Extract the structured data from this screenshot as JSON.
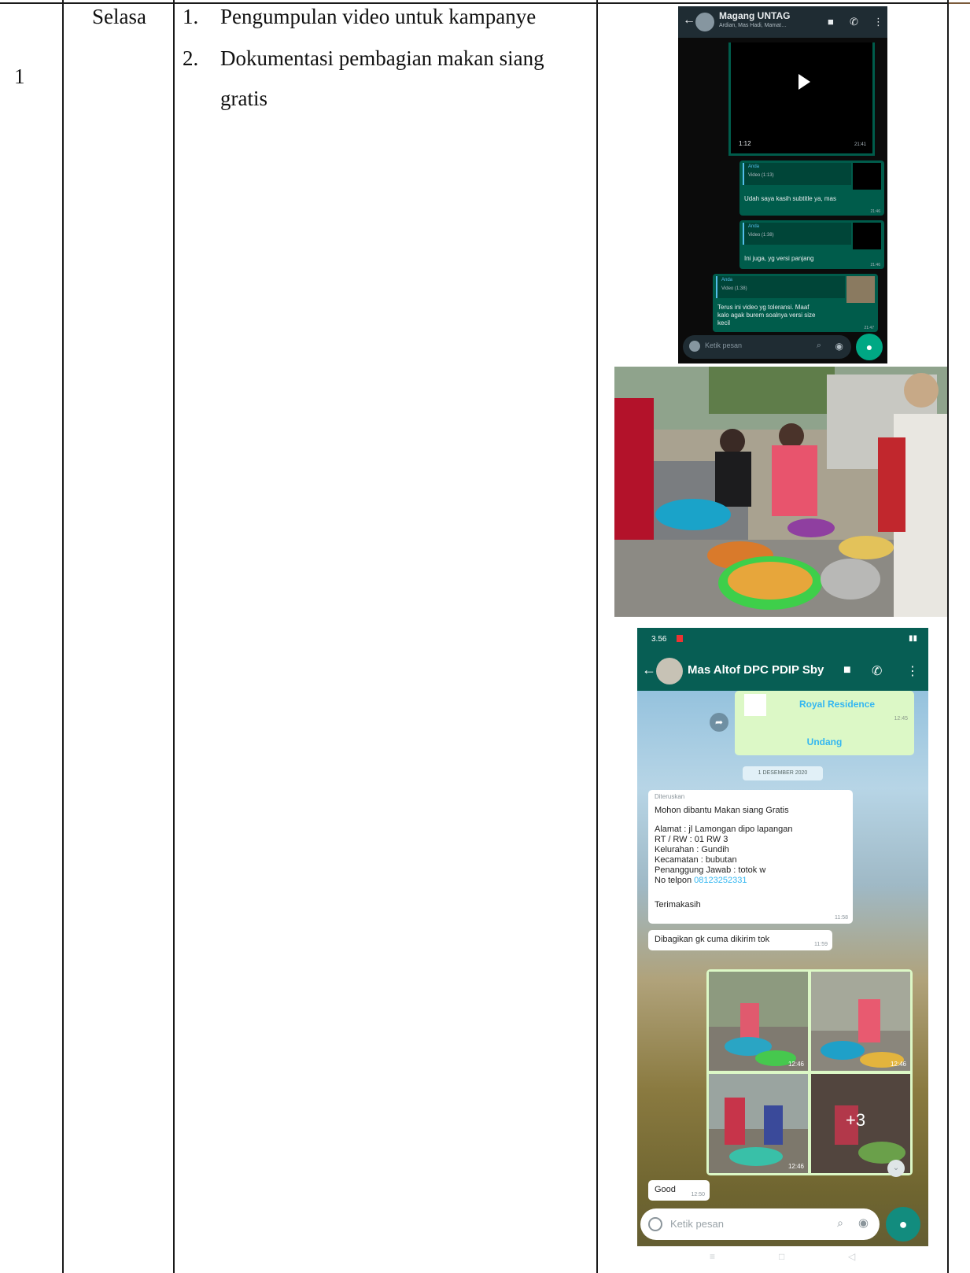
{
  "row": {
    "number": "1",
    "day": "Selasa",
    "activities": [
      {
        "num": "1.",
        "text": "Pengumpulan video untuk kampanye"
      },
      {
        "num": "2.",
        "text_line1": "Dokumentasi pembagian makan siang",
        "text_line2": "gratis"
      }
    ]
  },
  "chat1": {
    "title": "Magang UNTAG",
    "subtitle": "Ardian, Mas Hadi, Mamat…",
    "video_duration": "1:12",
    "video_time": "21:41",
    "msg1": {
      "quote_name": "Anda",
      "quote_media": "Video (1:13)",
      "text": "Udah saya kasih subtitle ya, mas",
      "time": "21:46"
    },
    "msg2": {
      "quote_name": "Anda",
      "quote_media": "Video (1:38)",
      "text": "Ini juga, yg versi panjang",
      "time": "21:46"
    },
    "msg3": {
      "quote_name": "Anda",
      "quote_media": "Video (1:38)",
      "text_line1": "Terus ini video yg toleransi. Maaf",
      "text_line2": "kalo agak burem soalnya versi size",
      "text_line3": "kecil",
      "time": "21:47"
    },
    "input_placeholder": "Ketik pesan"
  },
  "chat2": {
    "status_time": "3.56",
    "title": "Mas Altof DPC PDIP Sby",
    "card_title": "Royal Residence",
    "card_time": "12:45",
    "card_action": "Undang",
    "date_pill": "1 DESEMBER 2020",
    "forward_label": "Diteruskan",
    "message_lines": [
      "Mohon dibantu Makan siang Gratis",
      "",
      "Alamat : jl Lamongan dipo lapangan",
      "RT / RW : 01 RW 3",
      "Kelurahan : Gundih",
      "Kecamatan : bubutan",
      "Penanggung Jawab : totok w"
    ],
    "phone_prefix": "No telpon ",
    "phone": "08123252331",
    "thanks": "Terimakasih",
    "msg_time": "11:58",
    "reply": "Dibagikan gk cuma dikirim tok",
    "reply_time": "11:59",
    "photo_time": "12:46",
    "more_count": "+3",
    "good": "Good",
    "good_time": "12:50",
    "input_placeholder": "Ketik pesan"
  }
}
